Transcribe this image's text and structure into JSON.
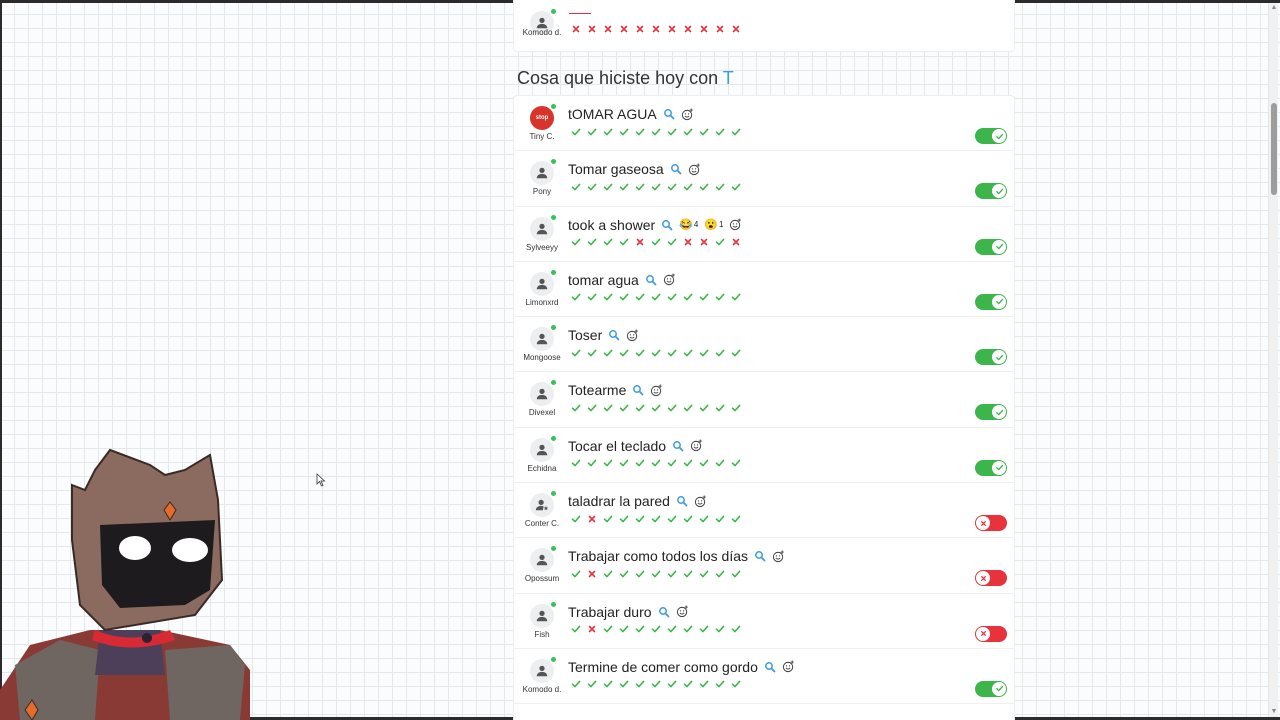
{
  "top_entry": {
    "username": "Komodo d.",
    "marks": [
      "x",
      "x",
      "x",
      "x",
      "x",
      "x",
      "x",
      "x",
      "x",
      "x",
      "x"
    ]
  },
  "section": {
    "title_prefix": "Cosa que hiciste hoy con ",
    "title_letter": "T"
  },
  "rows": [
    {
      "title": "tOMAR AGUA",
      "username": "Tiny C.",
      "avatar": "stop-sign",
      "avatar_text": "stop",
      "reactions": [],
      "marks": [
        "c",
        "c",
        "c",
        "c",
        "c",
        "c",
        "c",
        "c",
        "c",
        "c",
        "c"
      ],
      "toggle": true
    },
    {
      "title": "Tomar gaseosa",
      "username": "Pony",
      "avatar": "user",
      "reactions": [],
      "marks": [
        "c",
        "c",
        "c",
        "c",
        "c",
        "c",
        "c",
        "c",
        "c",
        "c",
        "c"
      ],
      "toggle": true
    },
    {
      "title": "took a shower",
      "username": "Sylveeyy",
      "avatar": "user",
      "reactions": [
        {
          "emoji": "😂",
          "count": "4"
        },
        {
          "emoji": "😮",
          "count": "1"
        }
      ],
      "marks": [
        "c",
        "c",
        "c",
        "c",
        "x",
        "c",
        "c",
        "x",
        "x",
        "c",
        "x"
      ],
      "toggle": true
    },
    {
      "title": "tomar agua",
      "username": "Limonxrd",
      "avatar": "user",
      "reactions": [],
      "marks": [
        "c",
        "c",
        "c",
        "c",
        "c",
        "c",
        "c",
        "c",
        "c",
        "c",
        "c"
      ],
      "toggle": true
    },
    {
      "title": "Toser",
      "username": "Mongoose",
      "avatar": "user",
      "reactions": [],
      "marks": [
        "c",
        "c",
        "c",
        "c",
        "c",
        "c",
        "c",
        "c",
        "c",
        "c",
        "c"
      ],
      "toggle": true
    },
    {
      "title": "Totearme",
      "username": "Divexel",
      "avatar": "user",
      "reactions": [],
      "marks": [
        "c",
        "c",
        "c",
        "c",
        "c",
        "c",
        "c",
        "c",
        "c",
        "c",
        "c"
      ],
      "toggle": true
    },
    {
      "title": "Tocar el teclado",
      "username": "Echidna",
      "avatar": "user",
      "reactions": [],
      "marks": [
        "c",
        "c",
        "c",
        "c",
        "c",
        "c",
        "c",
        "c",
        "c",
        "c",
        "c"
      ],
      "toggle": true
    },
    {
      "title": "taladrar la pared",
      "username": "Conter C.",
      "avatar": "user-star",
      "reactions": [],
      "marks": [
        "c",
        "x",
        "c",
        "c",
        "c",
        "c",
        "c",
        "c",
        "c",
        "c",
        "c"
      ],
      "toggle": false
    },
    {
      "title": "Trabajar como todos los días",
      "username": "Opossum",
      "avatar": "user",
      "reactions": [],
      "marks": [
        "c",
        "x",
        "c",
        "c",
        "c",
        "c",
        "c",
        "c",
        "c",
        "c",
        "c"
      ],
      "toggle": false
    },
    {
      "title": "Trabajar duro",
      "username": "Fish",
      "avatar": "user",
      "reactions": [],
      "marks": [
        "c",
        "x",
        "c",
        "c",
        "c",
        "c",
        "c",
        "c",
        "c",
        "c",
        "c"
      ],
      "toggle": false
    },
    {
      "title": "Termine de comer como gordo",
      "username": "Komodo d.",
      "avatar": "user",
      "reactions": [],
      "marks": [
        "c",
        "c",
        "c",
        "c",
        "c",
        "c",
        "c",
        "c",
        "c",
        "c",
        "c"
      ],
      "toggle": true
    }
  ],
  "colors": {
    "check": "#3cb54a",
    "cross": "#e8333c",
    "accent": "#3d9be0",
    "online": "#37c15a"
  }
}
